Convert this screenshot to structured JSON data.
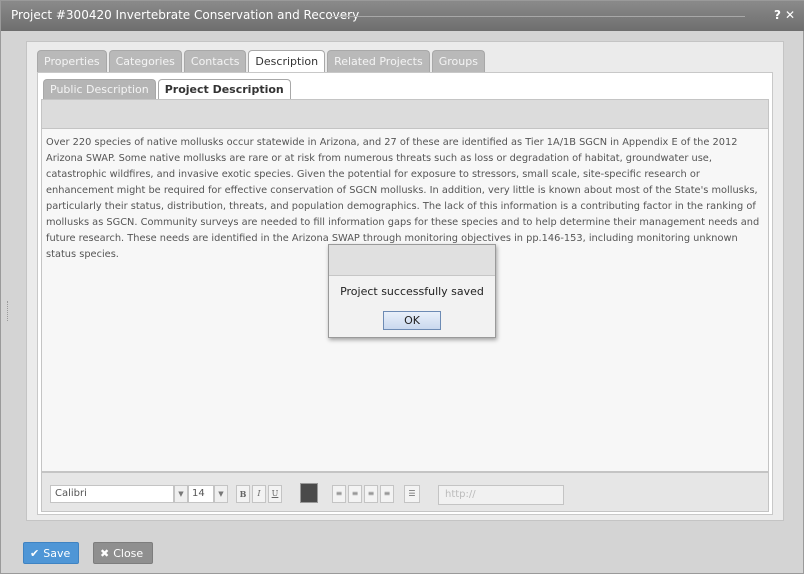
{
  "window": {
    "title": "Project #300420 Invertebrate Conservation and Recovery",
    "help_icon": "help-icon",
    "close_icon": "close-icon"
  },
  "tabs": [
    {
      "label": "Properties",
      "active": false
    },
    {
      "label": "Categories",
      "active": false
    },
    {
      "label": "Contacts",
      "active": false
    },
    {
      "label": "Description",
      "active": true
    },
    {
      "label": "Related Projects",
      "active": false
    },
    {
      "label": "Groups",
      "active": false
    }
  ],
  "subtabs": [
    {
      "label": "Public Description",
      "active": false
    },
    {
      "label": "Project Description",
      "active": true
    }
  ],
  "editor": {
    "text": "Over 220 species of native mollusks occur statewide in Arizona, and 27 of these are identified as Tier 1A/1B SGCN in Appendix E of the 2012 Arizona SWAP. Some native mollusks are rare or at risk from numerous threats such as loss or degradation of habitat, groundwater use, catastrophic wildfires, and invasive exotic species. Given the potential for exposure to stressors, small scale, site-specific research or enhancement might be required for effective conservation of SGCN mollusks. In addition, very little is known about most of the State's mollusks, particularly their status, distribution, threats, and population demographics. The lack of this information is a contributing factor in the ranking of mollusks as SGCN. Community surveys are needed to fill information gaps for these species and to help determine their management needs and future research. These needs are identified in the Arizona SWAP through monitoring objectives in pp.146-153, including monitoring unknown status species.",
    "font": "Calibri",
    "font_size": "14",
    "bold": "B",
    "italic": "I",
    "underline": "U",
    "link_placeholder": "http://",
    "text_color": "#4a4a4a"
  },
  "dialog": {
    "message": "Project successfully saved",
    "ok_label": "OK"
  },
  "footer": {
    "save_label": "Save",
    "close_label": "Close",
    "save_icon": "check-icon",
    "close_icon": "x-icon"
  },
  "colors": {
    "titlebar": "#7a7a7a",
    "save_button": "#4f96d6",
    "close_button": "#8f8f8f",
    "ok_button_border": "#6d8bb4"
  }
}
